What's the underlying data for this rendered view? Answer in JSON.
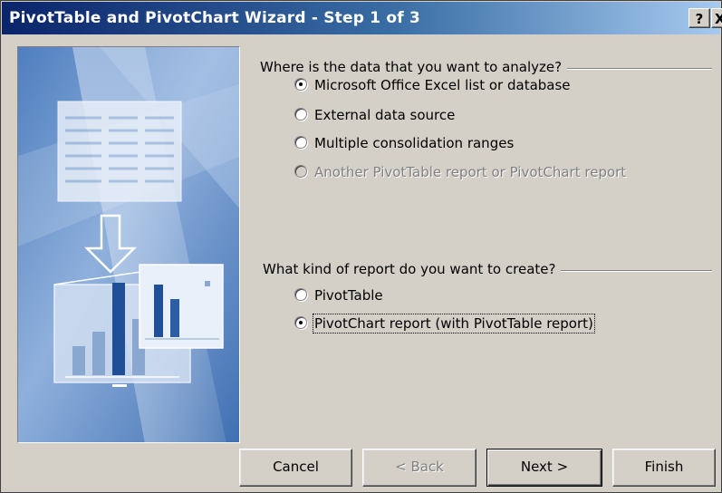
{
  "window": {
    "title": "PivotTable and PivotChart Wizard - Step 1 of 3",
    "help_label": "?",
    "close_label": "X"
  },
  "data_source_group": {
    "label": "Where is the data that you want to analyze?",
    "options": [
      {
        "label": "Microsoft Office Excel list or database",
        "checked": true,
        "disabled": false
      },
      {
        "label": "External data source",
        "checked": false,
        "disabled": false
      },
      {
        "label": "Multiple consolidation ranges",
        "checked": false,
        "disabled": false
      },
      {
        "label": "Another PivotTable report or PivotChart report",
        "checked": false,
        "disabled": true
      }
    ]
  },
  "report_kind_group": {
    "label": "What kind of report do you want to create?",
    "options": [
      {
        "label": "PivotTable",
        "checked": false,
        "disabled": false
      },
      {
        "label": "PivotChart report (with PivotTable report)",
        "checked": true,
        "disabled": false
      }
    ]
  },
  "buttons": {
    "cancel": "Cancel",
    "back": "< Back",
    "next": "Next >",
    "finish": "Finish"
  },
  "colors": {
    "title_start": "#0a246a",
    "title_end": "#a6caf0",
    "dialog_face": "#d4d0c8"
  }
}
